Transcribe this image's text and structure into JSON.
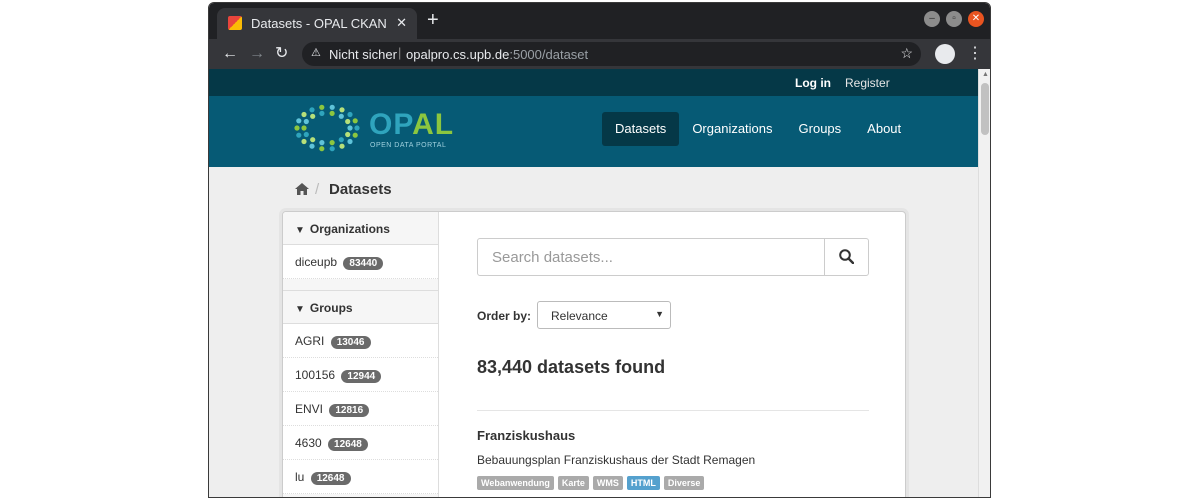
{
  "browser": {
    "tab_title": "Datasets - OPAL CKAN",
    "tab_close": "✕",
    "new_tab": "+",
    "insecure_label": "Nicht sicher",
    "url_host": "opalpro.cs.upb.de",
    "url_rest": ":5000/dataset"
  },
  "account": {
    "login": "Log in",
    "register": "Register"
  },
  "logo": {
    "brand_op": "OP",
    "brand_al": "AL",
    "tagline": "OPEN DATA PORTAL"
  },
  "nav": [
    {
      "label": "Datasets",
      "active": true
    },
    {
      "label": "Organizations",
      "active": false
    },
    {
      "label": "Groups",
      "active": false
    },
    {
      "label": "About",
      "active": false
    }
  ],
  "breadcrumb": {
    "current": "Datasets"
  },
  "facets": {
    "organizations": {
      "title": "Organizations",
      "items": [
        {
          "label": "diceupb",
          "count": "83440"
        }
      ]
    },
    "groups": {
      "title": "Groups",
      "items": [
        {
          "label": "AGRI",
          "count": "13046"
        },
        {
          "label": "100156",
          "count": "12944"
        },
        {
          "label": "ENVI",
          "count": "12816"
        },
        {
          "label": "4630",
          "count": "12648"
        },
        {
          "label": "lu",
          "count": "12648"
        }
      ]
    }
  },
  "search": {
    "placeholder": "Search datasets..."
  },
  "order_by": {
    "label": "Order by:",
    "selected": "Relevance"
  },
  "results": {
    "count_text": "83,440 datasets found",
    "datasets": [
      {
        "title": "Franziskushaus",
        "description": "Bebauungsplan Franziskushaus der Stadt Remagen",
        "formats": [
          "Webanwendung",
          "Karte",
          "WMS",
          "HTML",
          "Diverse"
        ]
      }
    ]
  },
  "colors": {
    "masthead": "#065a75",
    "account_bar": "#053847",
    "brand_blue": "#2fa4bd",
    "brand_green": "#8cc63f",
    "html_tag": "#55a1ce"
  }
}
